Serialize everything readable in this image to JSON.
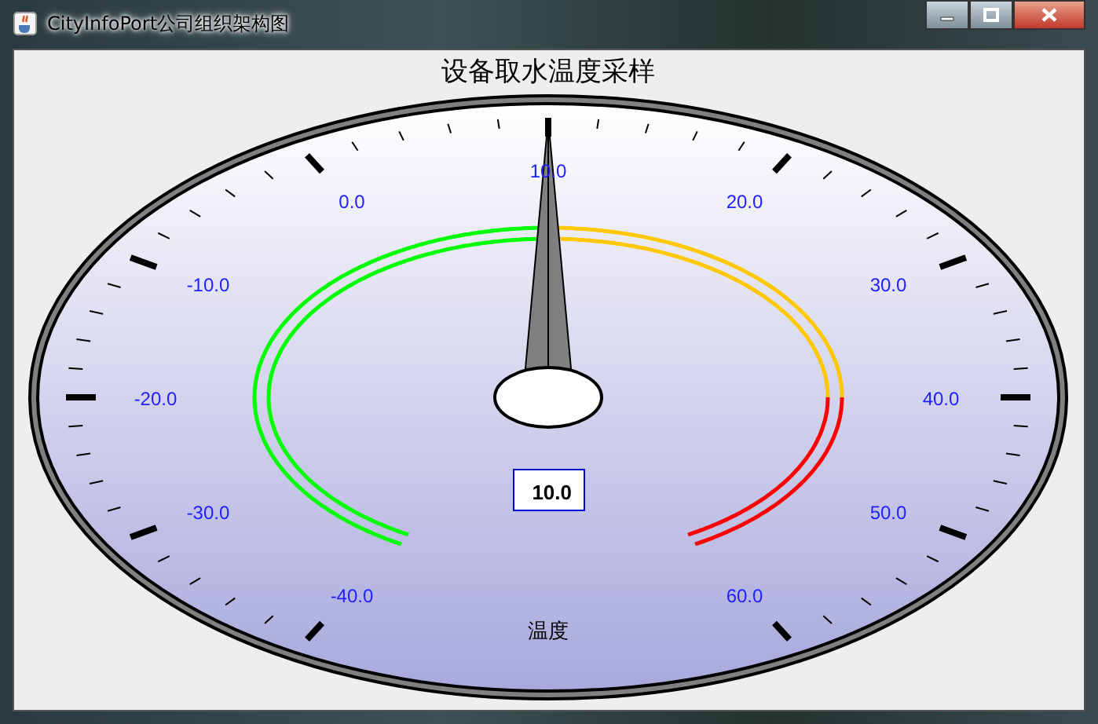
{
  "window": {
    "title": "CityInfoPort公司组织架构图"
  },
  "dial": {
    "title": "设备取水温度采样",
    "axis_label": "温度",
    "value_readout": "10.0",
    "needle": {
      "level": 0.5
    },
    "tick_labels": [
      "-40.0",
      "-30.0",
      "-20.0",
      "-10.0",
      "0.0",
      "10.0",
      "20.0",
      "30.0",
      "40.0",
      "50.0",
      "60.0"
    ],
    "bands": [
      {
        "color": "#00ff00"
      },
      {
        "color": "#00ff00"
      },
      {
        "color": "#00ff00"
      },
      {
        "color": "#00ff00"
      },
      {
        "color": "#00ff00"
      },
      {
        "color": "#ffc800"
      },
      {
        "color": "#ffc800"
      },
      {
        "color": "#ffc800"
      },
      {
        "color": "#ff0000"
      },
      {
        "color": "#ff0000"
      }
    ]
  }
}
